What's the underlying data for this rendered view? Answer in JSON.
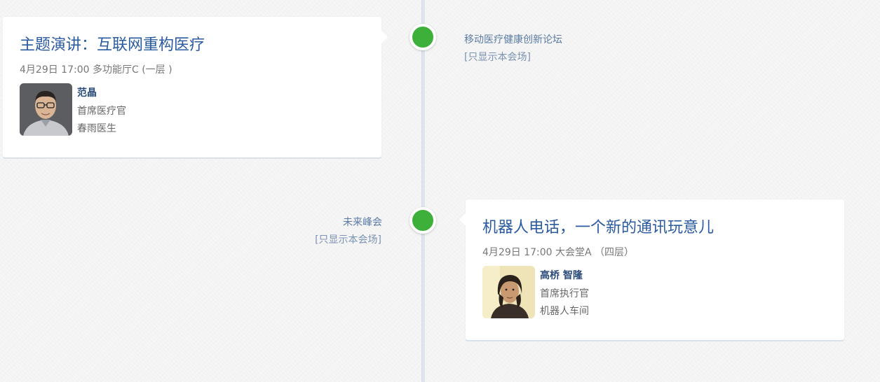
{
  "sessions": [
    {
      "title": "主题演讲：互联网重构医疗",
      "meta": "4月29日 17:00 多功能厅C (一层 )",
      "speaker": {
        "name": "范晶",
        "role": "首席医疗官",
        "org": "春雨医生"
      },
      "venue": "移动医疗健康创新论坛",
      "filter_link": "[只显示本会场]"
    },
    {
      "title": "机器人电话，一个新的通讯玩意儿",
      "meta": "4月29日 17:00 大会堂A （四层）",
      "speaker": {
        "name": "高桥 智隆",
        "role": "首席执行官",
        "org": "机器人车间"
      },
      "venue": "未来峰会",
      "filter_link": "[只显示本会场]"
    }
  ],
  "colors": {
    "dot": "#3db03a",
    "title": "#2a5a9f",
    "timeline": "#dde6ef"
  },
  "icons": {
    "avatar_1": "avatar-man-glasses",
    "avatar_2": "avatar-man-long-hair"
  }
}
